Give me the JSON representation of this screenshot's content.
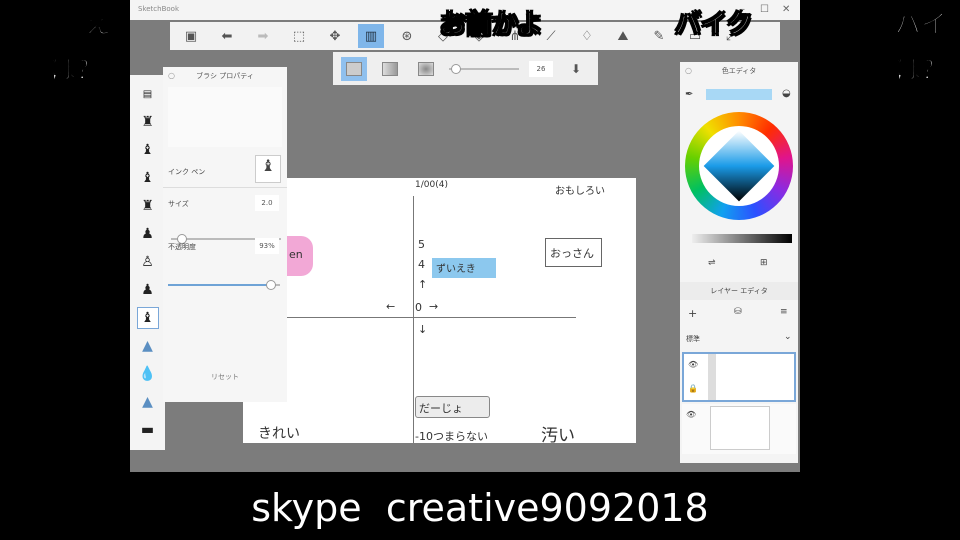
{
  "window": {
    "title": "SketchBook"
  },
  "subbar": {
    "size_value": "26"
  },
  "brush_panel": {
    "title": "ブラシ プロパティ",
    "brush_name": "インク ペン",
    "size_label": "サイズ",
    "size_value": "2.0",
    "size_fraction": 0.05,
    "opacity_label": "不透明度",
    "opacity_value": "93%",
    "opacity_fraction": 0.93,
    "reset_label": "リセット"
  },
  "canvas": {
    "texts": [
      "1/00(4)",
      "おもしろい",
      "en",
      "5",
      "4",
      "ずいえき",
      "0",
      "おっさん",
      "だーじょ",
      "きれい",
      "-10つまらない",
      "汚い",
      "い"
    ]
  },
  "color_panel": {
    "title": "色エディタ",
    "current_color": "#a8d8f5"
  },
  "layer_panel": {
    "title": "レイヤー エディタ",
    "blend_mode": "標準"
  },
  "comments": [
    "え",
    "は？",
    "お前かよ",
    "バイク",
    "バイ",
    "は？"
  ],
  "caption": "skype  creative9092018"
}
